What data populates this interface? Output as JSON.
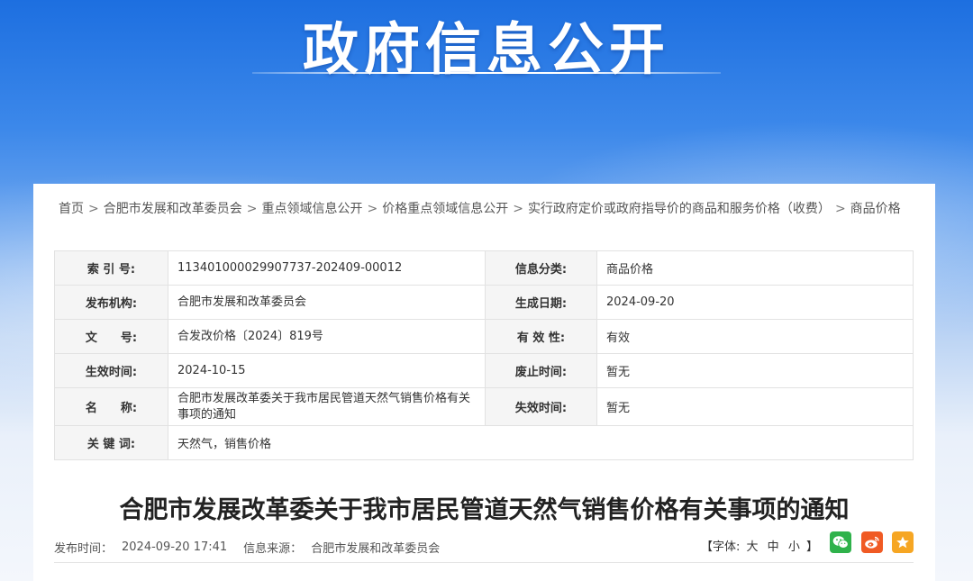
{
  "banner": {
    "title": "政府信息公开"
  },
  "breadcrumb": [
    "首页",
    "合肥市发展和改革委员会",
    "重点领域信息公开",
    "价格重点领域信息公开",
    "实行政府定价或政府指导价的商品和服务价格（收费）",
    "商品价格"
  ],
  "breadcrumb_sep": ">",
  "meta": {
    "index_label": "索 引 号:",
    "index_value": "113401000029907737-202409-00012",
    "category_label": "信息分类:",
    "category_value": "商品价格",
    "org_label": "发布机构:",
    "org_value": "合肥市发展和改革委员会",
    "gen_date_label": "生成日期:",
    "gen_date_value": "2024-09-20",
    "docno_label": "文　　号:",
    "docno_value": "合发改价格〔2024〕819号",
    "validity_label": "有 效 性:",
    "validity_value": "有效",
    "effective_label": "生效时间:",
    "effective_value": "2024-10-15",
    "repeal_label": "废止时间:",
    "repeal_value": "暂无",
    "name_label": "名　　称:",
    "name_value": "合肥市发展改革委关于我市居民管道天然气销售价格有关事项的通知",
    "expire_label": "失效时间:",
    "expire_value": "暂无",
    "keywords_label": "关 键 词:",
    "keywords_value": "天然气，销售价格"
  },
  "doc": {
    "title": "合肥市发展改革委关于我市居民管道天然气销售价格有关事项的通知",
    "publish_label": "发布时间：",
    "publish_value": "2024-09-20 17:41",
    "source_label": "信息来源：",
    "source_value": "合肥市发展和改革委员会"
  },
  "font_ctrl": {
    "open": "【字体:",
    "large": "大",
    "medium": "中",
    "small": "小",
    "close": "】"
  },
  "colors": {
    "wechat": "#2fb24b",
    "weibo": "#f05a24",
    "favorite": "#f6a623"
  }
}
